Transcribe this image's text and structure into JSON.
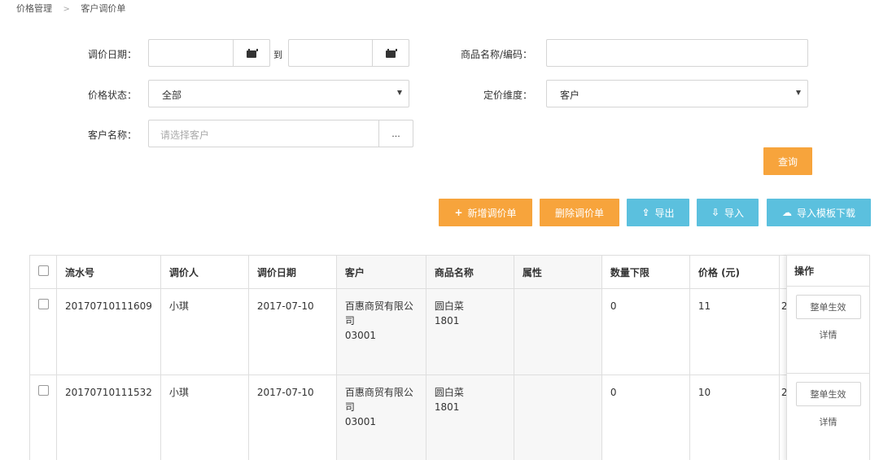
{
  "breadcrumb": [
    "价格管理",
    "客户调价单"
  ],
  "filters": {
    "date_label": "调价日期：",
    "date_to": "到",
    "product_label": "商品名称/编码：",
    "status_label": "价格状态：",
    "status_value": "全部",
    "dimension_label": "定价维度：",
    "dimension_value": "客户",
    "customer_label": "客户名称：",
    "customer_placeholder": "请选择客户",
    "customer_btn": "..."
  },
  "buttons": {
    "search": "查询",
    "new": "新增调价单",
    "delete": "删除调价单",
    "export": "导出",
    "import": "导入",
    "template": "导入模板下载"
  },
  "table": {
    "headers": [
      "流水号",
      "调价人",
      "调价日期",
      "客户",
      "商品名称",
      "属性",
      "数量下限",
      "价格 (元)",
      "操作"
    ],
    "rows": [
      {
        "serial": "20170710111609",
        "person": "小琪",
        "date": "2017-07-10",
        "customer_name": "百惠商贸有限公司",
        "customer_code": "03001",
        "product_name": "圆白菜",
        "product_code": "1801",
        "attribute": "",
        "min_qty": "0",
        "price": "11",
        "trunc": "2",
        "action_btn": "整单生效",
        "action_link": "详情"
      },
      {
        "serial": "20170710111532",
        "person": "小琪",
        "date": "2017-07-10",
        "customer_name": "百惠商贸有限公司",
        "customer_code": "03001",
        "product_name": "圆白菜",
        "product_code": "1801",
        "attribute": "",
        "min_qty": "0",
        "price": "10",
        "trunc": "2",
        "action_btn": "整单生效",
        "action_link": "详情"
      }
    ]
  }
}
